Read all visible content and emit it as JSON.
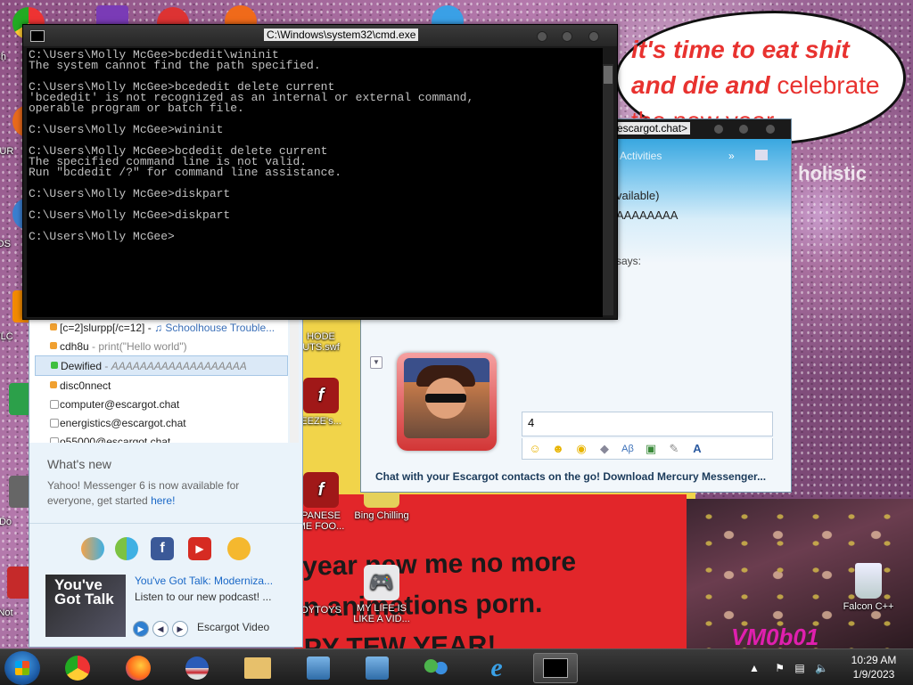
{
  "wallpaper": {
    "speech_line1": "it's time to eat shit",
    "speech_line2_italic": "and die and",
    "speech_line2_plain": " celebrate",
    "speech_line3": "the new year",
    "holistic": "holistic",
    "red_text_line1": "year new me no more",
    "red_text_line2": "n animations porn.",
    "red_text_line3": "PY TEW YEAR!",
    "vm_label": "VM0b01"
  },
  "desktop_icons": [
    {
      "label": "HODE\nUTS.swf"
    },
    {
      "label": "EEZE's..."
    },
    {
      "label": "PANESE\nME FOO..."
    },
    {
      "label": "Bing Chilling"
    },
    {
      "label": "OYTOYS"
    },
    {
      "label": "MY LIFE IS\nLIKE A VID..."
    },
    {
      "label": "Falcon C++"
    }
  ],
  "left_edge_labels": [
    "Ch",
    "D",
    "FUR",
    "OS",
    "LAL",
    "VLC",
    "Pl",
    "Do",
    "Not"
  ],
  "cmd": {
    "title": "C:\\Windows\\system32\\cmd.exe",
    "lines": [
      "C:\\Users\\Molly McGee>bcdedit\\wininit",
      "The system cannot find the path specified.",
      "",
      "C:\\Users\\Molly McGee>bcededit delete current",
      "'bcededit' is not recognized as an internal or external command,",
      "operable program or batch file.",
      "",
      "C:\\Users\\Molly McGee>wininit",
      "",
      "C:\\Users\\Molly McGee>bcdedit delete current",
      "The specified command line is not valid.",
      "Run \"bcdedit /?\" for command line assistance.",
      "",
      "C:\\Users\\Molly McGee>diskpart",
      "",
      "C:\\Users\\Molly McGee>diskpart",
      "",
      "C:\\Users\\Molly McGee>"
    ]
  },
  "contacts": {
    "rows": [
      {
        "name": "[c=2]slurpp[/c=12]",
        "sep": " - ",
        "song": "♫ Schoolhouse Trouble...",
        "status_color": "#f0a030"
      },
      {
        "name": "cdh8u",
        "sep": " - ",
        "msg": "print(\"Hello world\")",
        "status_color": "#f0a030"
      },
      {
        "name": "Dewified",
        "sep": " - ",
        "msg": "AAAAAAAAAAAAAAAAAAA",
        "status_color": "#3fbf3f",
        "selected": true
      },
      {
        "name": "disc0nnect",
        "status_color": "#f0a030"
      },
      {
        "name": "computer@escargot.chat",
        "status_color": "#ffffff"
      },
      {
        "name": "energistics@escargot.chat",
        "status_color": "#ffffff"
      },
      {
        "name": "o55000@escargot.chat",
        "status_color": "#ffffff"
      }
    ],
    "whats_new": "What's new",
    "yahoo_text": "Yahoo! Messenger 6 is now available for everyone, get started ",
    "yahoo_link": "here!",
    "promo_image_text": "You've Got Talk",
    "promo_title": "You've Got Talk: Moderniza...",
    "promo_desc": "Listen to our new podcast! ...",
    "escargot_video": "Escargot Video"
  },
  "chat": {
    "title": "escargot.chat>",
    "activities": "Activities",
    "available": "vailable)",
    "status_msg": "AAAAAAAA",
    "says": "says:",
    "input_value": "4",
    "promo": "Chat with your Escargot contacts on the go! Download Mercury Messenger..."
  },
  "taskbar": {
    "time": "10:29 AM",
    "date": "1/9/2023"
  }
}
